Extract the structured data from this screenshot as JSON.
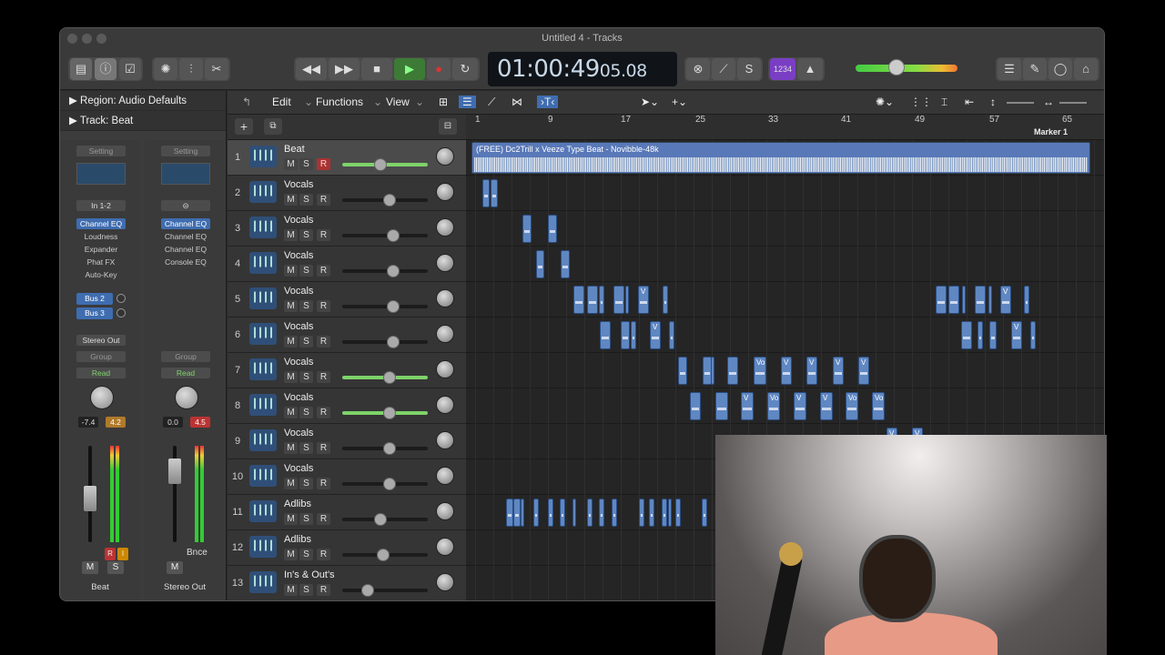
{
  "window": {
    "title": "Untitled 4 - Tracks"
  },
  "transport": {
    "time_main": "01:00:49",
    "time_sub": "05.08"
  },
  "inspector": {
    "region_label": "Region: Audio Defaults",
    "track_label": "Track: Beat",
    "strip1": {
      "setting": "Setting",
      "input": "In 1-2",
      "plugins": [
        "Channel EQ",
        "Loudness",
        "Expander",
        "Phat FX",
        "Auto-Key"
      ],
      "sends": [
        "Bus 2",
        "Bus 3"
      ],
      "output": "Stereo Out",
      "group": "Group",
      "automation": "Read",
      "vol": "-7.4",
      "peak": "4.2",
      "mute": "M",
      "solo": "S",
      "name": "Beat"
    },
    "strip2": {
      "setting": "Setting",
      "plugins": [
        "Channel EQ",
        "Channel EQ",
        "Channel EQ",
        "Console EQ"
      ],
      "group": "Group",
      "automation": "Read",
      "vol": "0.0",
      "peak": "4.5",
      "bounce": "Bnce",
      "mute": "M",
      "name": "Stereo Out"
    }
  },
  "arrange_menu": {
    "edit": "Edit",
    "functions": "Functions",
    "view": "View"
  },
  "ruler": [
    "1",
    "9",
    "17",
    "25",
    "33",
    "41",
    "49",
    "57",
    "65"
  ],
  "marker": "Marker 1",
  "beat_region": "(FREE) Dc2Trill x Veeze Type Beat - Novibble-48k",
  "tracks": [
    {
      "num": "1",
      "name": "Beat",
      "vol": 0.45,
      "filled": true,
      "rec": true
    },
    {
      "num": "2",
      "name": "Vocals",
      "vol": 0.55,
      "filled": false
    },
    {
      "num": "3",
      "name": "Vocals",
      "vol": 0.6,
      "filled": false
    },
    {
      "num": "4",
      "name": "Vocals",
      "vol": 0.6,
      "filled": false
    },
    {
      "num": "5",
      "name": "Vocals",
      "vol": 0.6,
      "filled": false
    },
    {
      "num": "6",
      "name": "Vocals",
      "vol": 0.6,
      "filled": false
    },
    {
      "num": "7",
      "name": "Vocals",
      "vol": 0.55,
      "filled": true
    },
    {
      "num": "8",
      "name": "Vocals",
      "vol": 0.55,
      "filled": true
    },
    {
      "num": "9",
      "name": "Vocals",
      "vol": 0.55,
      "filled": false
    },
    {
      "num": "10",
      "name": "Vocals",
      "vol": 0.55,
      "filled": false
    },
    {
      "num": "11",
      "name": "Adlibs",
      "vol": 0.45,
      "filled": false
    },
    {
      "num": "12",
      "name": "Adlibs",
      "vol": 0.48,
      "filled": false
    },
    {
      "num": "13",
      "name": "In's & Out's",
      "vol": 0.3,
      "filled": false
    }
  ],
  "button_labels": {
    "m": "M",
    "s": "S",
    "r": "R"
  },
  "region_labels": {
    "v": "V",
    "vo": "Vo"
  }
}
